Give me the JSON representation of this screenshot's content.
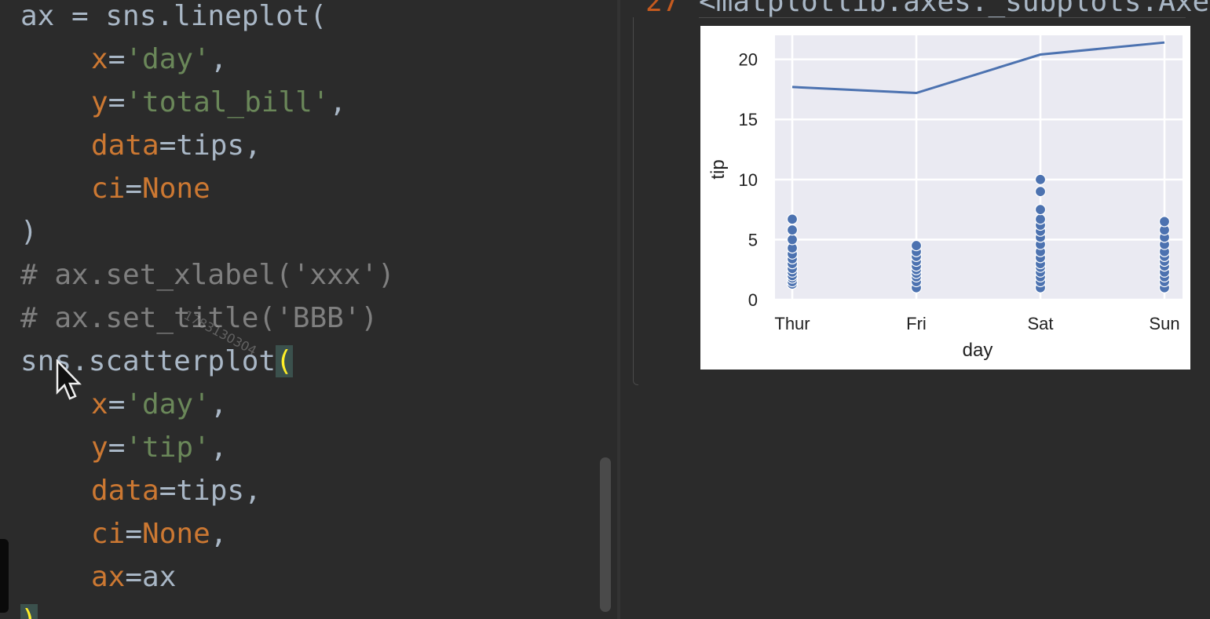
{
  "editor": {
    "lines": [
      [
        {
          "t": "ax = sns.lineplot(",
          "c": "plain"
        }
      ],
      [
        {
          "t": "x",
          "c": "kw"
        },
        {
          "t": "=",
          "c": "plain"
        },
        {
          "t": "'day'",
          "c": "str"
        },
        {
          "t": ",",
          "c": "plain"
        }
      ],
      [
        {
          "t": "y",
          "c": "kw"
        },
        {
          "t": "=",
          "c": "plain"
        },
        {
          "t": "'total_bill'",
          "c": "str"
        },
        {
          "t": ",",
          "c": "plain"
        }
      ],
      [
        {
          "t": "data",
          "c": "kw"
        },
        {
          "t": "=tips,",
          "c": "plain"
        }
      ],
      [
        {
          "t": "ci",
          "c": "kw"
        },
        {
          "t": "=",
          "c": "plain"
        },
        {
          "t": "None",
          "c": "kw"
        }
      ],
      [
        {
          "t": ")",
          "c": "plain"
        }
      ],
      [
        {
          "t": "# ax.set_xlabel('xxx')",
          "c": "cmt"
        }
      ],
      [
        {
          "t": "# ax.set_title('BBB')",
          "c": "cmt"
        }
      ],
      [
        {
          "t": "sns.scatterplot",
          "c": "plain"
        },
        {
          "t": "(",
          "c": "paren-hl"
        }
      ],
      [
        {
          "t": "x",
          "c": "kw"
        },
        {
          "t": "=",
          "c": "plain"
        },
        {
          "t": "'day'",
          "c": "str"
        },
        {
          "t": ",",
          "c": "plain"
        }
      ],
      [
        {
          "t": "y",
          "c": "kw"
        },
        {
          "t": "=",
          "c": "plain"
        },
        {
          "t": "'tip'",
          "c": "str"
        },
        {
          "t": ",",
          "c": "plain"
        }
      ],
      [
        {
          "t": "data",
          "c": "kw"
        },
        {
          "t": "=tips,",
          "c": "plain"
        }
      ],
      [
        {
          "t": "ci",
          "c": "kw"
        },
        {
          "t": "=",
          "c": "plain"
        },
        {
          "t": "None",
          "c": "kw"
        },
        {
          "t": ",",
          "c": "plain"
        }
      ],
      [
        {
          "t": "ax",
          "c": "kw"
        },
        {
          "t": "=ax",
          "c": "plain"
        }
      ],
      [
        {
          "t": ")",
          "c": "paren-hl"
        }
      ]
    ],
    "indented": [
      false,
      true,
      true,
      true,
      true,
      false,
      false,
      false,
      false,
      true,
      true,
      true,
      true,
      true,
      false
    ],
    "watermark": "1783130304"
  },
  "output": {
    "prompt_number": "27",
    "repr_text": "<matplotlib.axes._subplots.AxesS"
  },
  "chart_data": {
    "type": "line+scatter",
    "categories": [
      "Thur",
      "Fri",
      "Sat",
      "Sun"
    ],
    "xlabel": "day",
    "ylabel": "tip",
    "ylim": [
      0,
      22
    ],
    "yticks": [
      0,
      5,
      10,
      15,
      20
    ],
    "grid": true,
    "background": "#eaeaf2",
    "series_color": "#4c72b0",
    "line_series": {
      "values": [
        17.7,
        17.2,
        20.4,
        21.4
      ]
    },
    "scatter_series": {
      "points": {
        "Thur": [
          1.3,
          1.5,
          1.8,
          2.0,
          2.3,
          2.6,
          3.0,
          3.4,
          3.8,
          4.3,
          5.0,
          5.8,
          6.7
        ],
        "Fri": [
          1.0,
          1.5,
          1.9,
          2.2,
          2.5,
          2.8,
          3.2,
          3.6,
          4.0,
          4.5
        ],
        "Sat": [
          1.0,
          1.5,
          1.9,
          2.3,
          2.7,
          3.0,
          3.5,
          4.0,
          4.6,
          5.2,
          5.7,
          6.2,
          6.7,
          7.5,
          9.0,
          10.0
        ],
        "Sun": [
          1.0,
          1.5,
          1.9,
          2.3,
          2.8,
          3.2,
          3.6,
          4.0,
          4.6,
          5.2,
          5.8,
          6.5
        ]
      }
    }
  }
}
